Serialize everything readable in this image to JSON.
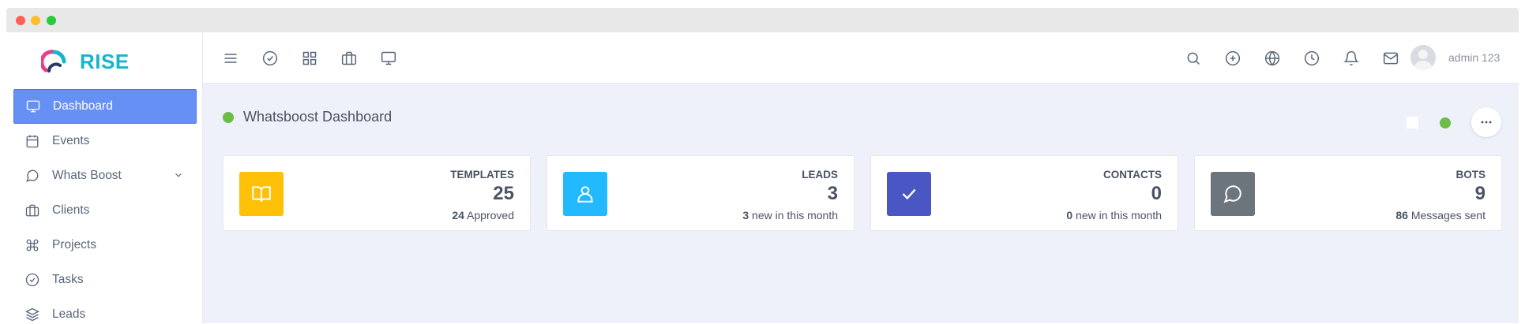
{
  "app": {
    "brand": "RISE",
    "brand_color": "#14b5cd"
  },
  "sidebar": {
    "items": [
      {
        "label": "Dashboard",
        "icon": "monitor-icon",
        "active": true
      },
      {
        "label": "Events",
        "icon": "calendar-icon"
      },
      {
        "label": "Whats Boost",
        "icon": "chat-icon",
        "has_submenu": true
      },
      {
        "label": "Clients",
        "icon": "briefcase-icon"
      },
      {
        "label": "Projects",
        "icon": "command-icon"
      },
      {
        "label": "Tasks",
        "icon": "check-circle-icon"
      },
      {
        "label": "Leads",
        "icon": "layers-icon"
      }
    ],
    "active_color": "#6690f4"
  },
  "topbar": {
    "left_icons": [
      "menu-icon",
      "check-circle-icon",
      "grid-icon",
      "briefcase-icon",
      "monitor-icon"
    ],
    "right_icons": [
      "search-icon",
      "plus-circle-icon",
      "globe-icon",
      "clock-icon",
      "bell-icon",
      "mail-icon"
    ],
    "user_name": "admin 123"
  },
  "page": {
    "title": "Whatsboost Dashboard",
    "status_color": "#6cbd45"
  },
  "cards": [
    {
      "label": "TEMPLATES",
      "value": "25",
      "sub_count": "24",
      "sub_text": " Approved",
      "icon": "book-icon",
      "color": "#ffc107"
    },
    {
      "label": "LEADS",
      "value": "3",
      "sub_count": "3",
      "sub_text": " new in this month",
      "icon": "user-icon",
      "color": "#22b9ff"
    },
    {
      "label": "CONTACTS",
      "value": "0",
      "sub_count": "0",
      "sub_text": " new in this month",
      "icon": "check-icon",
      "color": "#4a56c4"
    },
    {
      "label": "BOTS",
      "value": "9",
      "sub_count": "86",
      "sub_text": " Messages sent",
      "icon": "message-circle-icon",
      "color": "#6c757d"
    }
  ]
}
